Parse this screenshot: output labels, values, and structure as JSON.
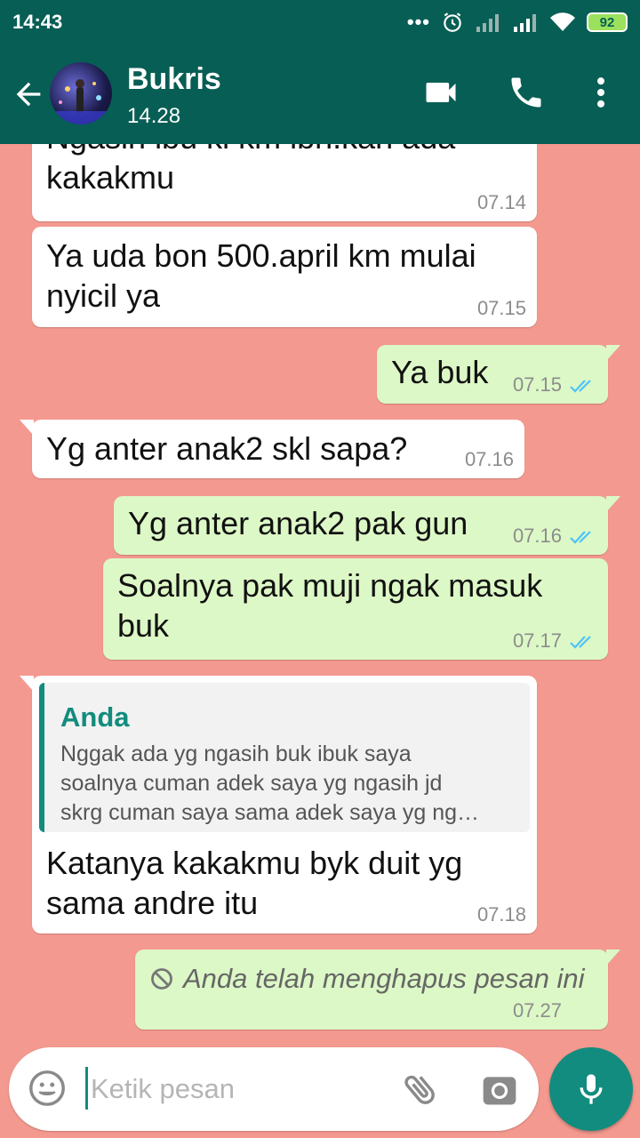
{
  "status_bar": {
    "time": "14:43",
    "dots": "•••",
    "battery": "92"
  },
  "header": {
    "contact_name": "Bukris",
    "subtitle": "14.28"
  },
  "messages": [
    {
      "direction": "in",
      "lines": [
        "Ngasih ibu ki km ibn.kan ada",
        "kakakmu"
      ],
      "time": "07.14"
    },
    {
      "direction": "in",
      "lines": [
        "Ya uda bon 500.april km mulai",
        "nyicil ya"
      ],
      "time": "07.15"
    },
    {
      "direction": "out",
      "lines": [
        "Ya buk"
      ],
      "time": "07.15",
      "read": true
    },
    {
      "direction": "in",
      "lines": [
        "Yg anter anak2 skl sapa?"
      ],
      "time": "07.16"
    },
    {
      "direction": "out",
      "lines": [
        "Yg anter anak2 pak gun"
      ],
      "time": "07.16",
      "read": true
    },
    {
      "direction": "out",
      "lines": [
        "Soalnya pak muji ngak masuk",
        "buk"
      ],
      "time": "07.17",
      "read": true
    },
    {
      "direction": "in",
      "quote": {
        "author": "Anda",
        "lines": [
          "Nggak ada yg ngasih buk ibuk saya",
          "soalnya cuman adek saya yg ngasih jd",
          "skrg cuman saya sama adek saya yg ng…"
        ]
      },
      "lines": [
        "Katanya kakakmu byk duit yg",
        "sama andre itu"
      ],
      "time": "07.18"
    },
    {
      "direction": "out",
      "deleted": true,
      "text": "Anda telah menghapus pesan ini",
      "time": "07.27"
    }
  ],
  "input": {
    "placeholder": "Ketik pesan",
    "value": ""
  },
  "colors": {
    "header": "#075e54",
    "chat_background": "#f4998f",
    "incoming_bubble": "#ffffff",
    "outgoing_bubble": "#dcf8c6",
    "accent": "#128c7e",
    "read_ticks": "#4fc3f7"
  },
  "icons": [
    "back-arrow-icon",
    "video-call-icon",
    "phone-icon",
    "more-vert-icon",
    "double-check-icon",
    "blocked-icon",
    "emoji-icon",
    "paperclip-icon",
    "camera-icon",
    "mic-icon"
  ]
}
